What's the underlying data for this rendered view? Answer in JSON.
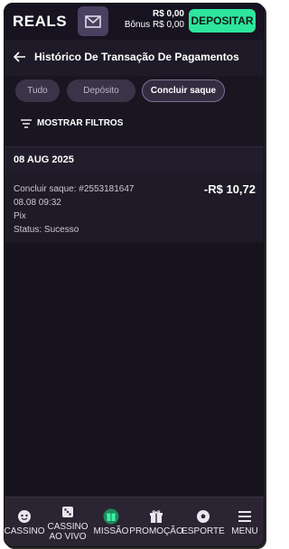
{
  "topbar": {
    "logo": "REALS",
    "balance_main": "R$ 0,00",
    "balance_bonus": "Bônus R$ 0,00",
    "deposit_label": "DEPOSITAR"
  },
  "header": {
    "title": "Histórico De Transação De Pagamentos"
  },
  "tabs": [
    {
      "label": "Tudo",
      "active": false
    },
    {
      "label": "Depósito",
      "active": false
    },
    {
      "label": "Concluir saque",
      "active": true
    }
  ],
  "filters_label": "MOSTRAR FILTROS",
  "date_group": "08 AUG 2025",
  "transaction": {
    "id_line": "Concluir saque: #2553181647",
    "datetime": "08.08 09:32",
    "method": "Pix",
    "status": "Status: Sucesso",
    "amount": "-R$ 10,72"
  },
  "bottom_nav": [
    {
      "label": "CASSINO",
      "icon": "casino-icon"
    },
    {
      "label": "CASSINO AO VIVO",
      "icon": "dice-icon"
    },
    {
      "label": "MISSÃO",
      "icon": "mission-gift-icon"
    },
    {
      "label": "PROMOÇÃO",
      "icon": "gift-icon"
    },
    {
      "label": "ESPORTE",
      "icon": "soccer-ball-icon"
    },
    {
      "label": "MENU",
      "icon": "hamburger-icon"
    }
  ],
  "colors": {
    "accent": "#2ee59d",
    "background": "#1a1621"
  }
}
